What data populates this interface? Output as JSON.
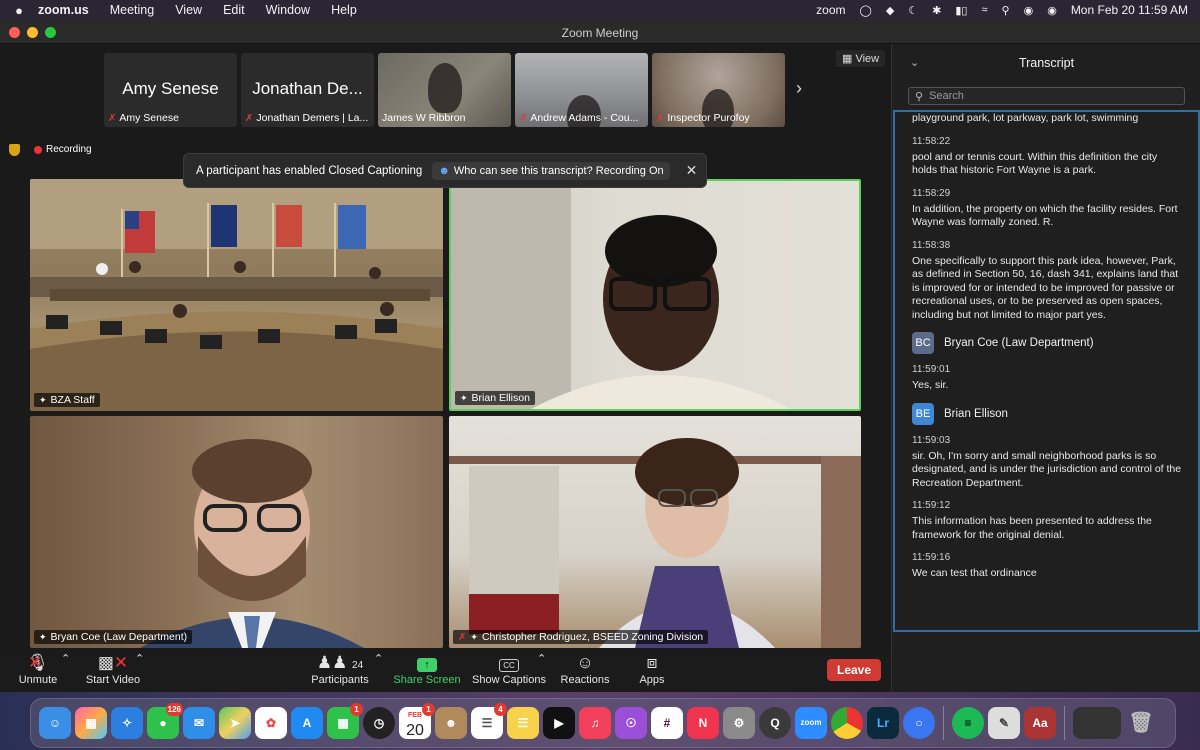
{
  "menubar": {
    "app_name": "zoom.us",
    "items": [
      "Meeting",
      "View",
      "Edit",
      "Window",
      "Help"
    ],
    "status_zoom": "zoom",
    "datetime": "Mon Feb 20  11:59 AM"
  },
  "window": {
    "title": "Zoom Meeting"
  },
  "gallery": {
    "thumbs": [
      {
        "big_name": "Amy Senese",
        "label": "Amy Senese"
      },
      {
        "big_name": "Jonathan De...",
        "label": "Jonathan Demers | La..."
      },
      {
        "label": "James W Ribbron"
      },
      {
        "label": "Andrew Adams - Cou..."
      },
      {
        "label": "Inspector Purofoy"
      }
    ],
    "view_label": "View"
  },
  "recording": {
    "label": "Recording"
  },
  "cc_banner": {
    "message": "A participant has enabled Closed Captioning",
    "who_label": "Who can see this transcript? Recording On"
  },
  "tiles": {
    "bza": "BZA Staff",
    "brian": "Brian Ellison",
    "bryan": "Bryan Coe (Law Department)",
    "chris": "Christopher Rodriguez, BSEED Zoning Division"
  },
  "toolbar": {
    "unmute": "Unmute",
    "start_video": "Start Video",
    "participants": "Participants",
    "participants_count": "24",
    "share_screen": "Share Screen",
    "show_captions": "Show Captions",
    "cc_icon": "CC",
    "reactions": "Reactions",
    "apps": "Apps",
    "leave": "Leave"
  },
  "transcript": {
    "title": "Transcript",
    "search_placeholder": "Search",
    "top_text": "playground park, lot parkway, park lot, swimming",
    "e1_time": "11:58:22",
    "e1_text": "pool and or tennis court. Within this definition the city holds that historic Fort Wayne is a park.",
    "e2_time": "11:58:29",
    "e2_text": "In addition, the property on which the facility resides. Fort Wayne was formally zoned. R.",
    "e3_time": "11:58:38",
    "e3_text": "One specifically to support this park idea, however, Park, as defined in Section 50, 16, dash 341, explains land that is improved for or intended to be improved for passive or recreational uses, or to be preserved as open spaces, including but not limited to major part yes.",
    "s1_initials": "BC",
    "s1_name": "Bryan Coe (Law Department)",
    "e4_time": "11:59:01",
    "e4_text": "Yes, sir.",
    "s2_initials": "BE",
    "s2_name": "Brian Ellison",
    "e5_time": "11:59:03",
    "e5_text": "sir. Oh, I'm sorry and small neighborhood parks is so designated, and is under the jurisdiction and control of the Recreation Department.",
    "e6_time": "11:59:12",
    "e6_text": "This information has been presented to address the framework for the original denial.",
    "e7_time": "11:59:16",
    "e7_text": "We can test that ordinance"
  },
  "dock": {
    "messages_badge": "126",
    "calendar_month": "FEB",
    "calendar_day": "20",
    "calendar_badge": "1",
    "facetime_badge": "1",
    "reminders_badge": "4",
    "zoom_label": "zoom",
    "lr_label": "Lr",
    "dict_label": "Aa"
  },
  "colors": {
    "active_speaker": "#5bd15b",
    "leave": "#cf3b34",
    "share_green": "#3ed16a",
    "transcript_focus": "#2f6ea8"
  }
}
